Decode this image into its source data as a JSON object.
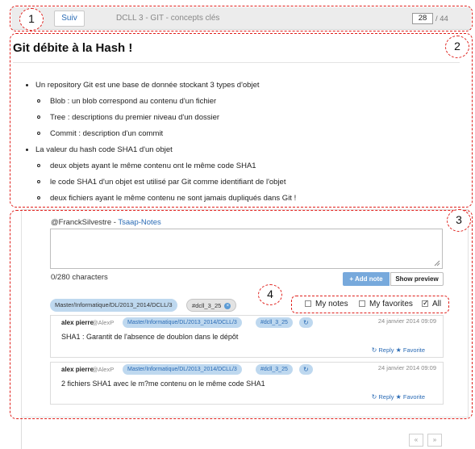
{
  "topbar": {
    "next_label": "Suiv",
    "title": "DCLL 3 - GIT - concepts clés",
    "current_page": "28",
    "total_pages": "/ 44"
  },
  "slide": {
    "title": "Git débite à la Hash !",
    "bullets": [
      {
        "level": 1,
        "text": "Un repository Git est une base de donnée stockant 3 types d'objet"
      },
      {
        "level": 2,
        "text": "Blob : un blob correspond au contenu d'un fichier"
      },
      {
        "level": 2,
        "text": "Tree : descriptions du premier niveau d'un dossier"
      },
      {
        "level": 2,
        "text": "Commit : description d'un commit"
      },
      {
        "level": 1,
        "text": "La valeur du hash code SHA1 d'un objet"
      },
      {
        "level": 2,
        "text": "deux objets ayant le même contenu ont le même code SHA1"
      },
      {
        "level": 2,
        "text": "le code SHA1 d'un objet est utilisé par Git comme identifiant de l'objet"
      },
      {
        "level": 2,
        "text": "deux fichiers ayant le même contenu ne sont jamais dupliqués dans Git !"
      }
    ]
  },
  "notes": {
    "author_handle": "@FranckSilvestre - ",
    "app_link": "Tsaap-Notes",
    "char_count": "0/280 characters",
    "add_note_label": "Add note",
    "show_preview_label": "Show preview",
    "context_tag": "Master/Informatique/DL/2013_2014/DCLL/3",
    "fragment_tag": "#dcll_3_25",
    "filters": {
      "my_notes": "My notes",
      "my_favorites": "My favorites",
      "all": "All",
      "all_checked": true
    },
    "items": [
      {
        "author": "alex pierre",
        "handle": "@AlexP",
        "context": "Master/Informatique/DL/2013_2014/DCLL/3",
        "fragment": "#dcll_3_25",
        "date": "24 janvier 2014 09:09",
        "text": "SHA1 : Garantit de l'absence de doublon dans le dépôt",
        "reply": "Reply",
        "favorite": "Favorite"
      },
      {
        "author": "alex pierre",
        "handle": "@AlexP",
        "context": "Master/Informatique/DL/2013_2014/DCLL/3",
        "fragment": "#dcll_3_25",
        "date": "24 janvier 2014 09:09",
        "text": "2 fichiers SHA1 avec le m?me contenu on le même code SHA1",
        "reply": "Reply",
        "favorite": "Favorite"
      }
    ]
  },
  "pager": {
    "prev": "«",
    "next": "»"
  },
  "callouts": [
    "1",
    "2",
    "3",
    "4"
  ],
  "colors": {
    "annotation_red": "#e0201c",
    "link_blue": "#2a6bb5",
    "tag_blue": "#bed8ef",
    "button_blue": "#77a9dc"
  }
}
